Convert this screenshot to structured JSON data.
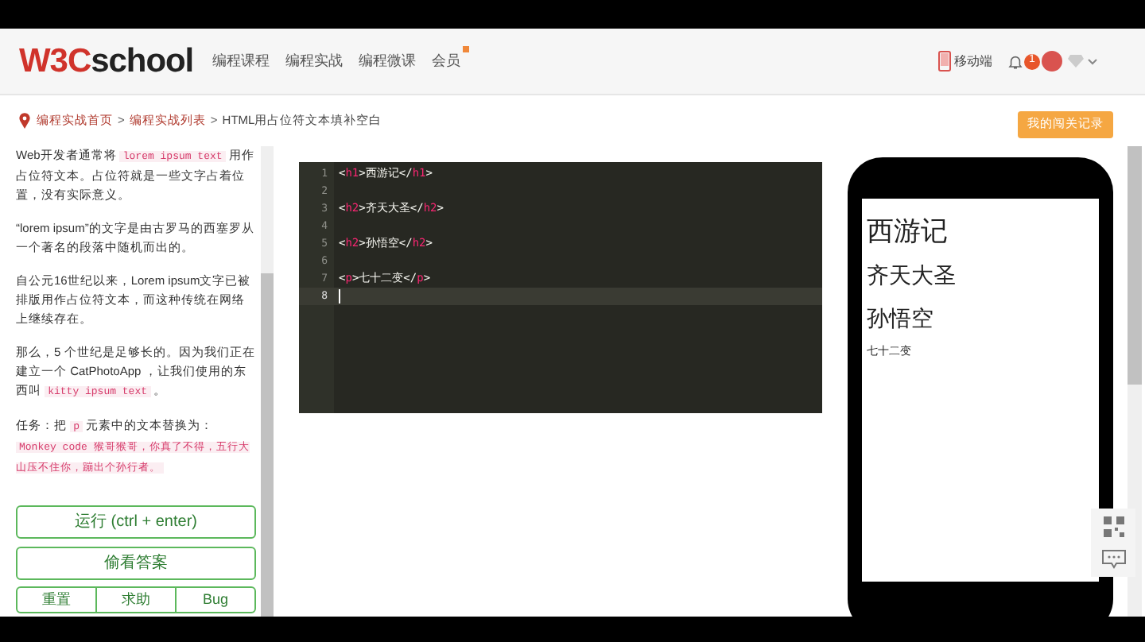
{
  "header": {
    "logo": {
      "accent": "W3C",
      "rest": "school"
    },
    "nav": [
      {
        "label": "编程课程",
        "badge": false
      },
      {
        "label": "编程实战",
        "badge": false
      },
      {
        "label": "编程微课",
        "badge": false
      },
      {
        "label": "会员",
        "badge": true
      }
    ],
    "mobile_link": "移动端",
    "notification_count": "1"
  },
  "breadcrumb": {
    "items": [
      "编程实战首页",
      "编程实战列表",
      "HTML用占位符文本填补空白"
    ],
    "separator": ">"
  },
  "record_button": "我的闯关记录",
  "lesson": [
    [
      {
        "kind": "text",
        "text": "Web开发者通常将 "
      },
      {
        "kind": "code",
        "text": "lorem ipsum text"
      },
      {
        "kind": "text",
        "text": " 用作占位符文本。占位符就是一些文字占着位置，没有实际意义。"
      }
    ],
    [
      {
        "kind": "text",
        "text": "“lorem ipsum”的文字是由古罗马的西塞罗从一个著名的段落中随机而出的。"
      }
    ],
    [
      {
        "kind": "text",
        "text": "自公元16世纪以来，Lorem ipsum文字已被排版用作占位符文本，而这种传统在网络上继续存在。"
      }
    ],
    [
      {
        "kind": "text",
        "text": "那么，5 个世纪是足够长的。因为我们正在建立一个 CatPhotoApp ，让我们使用的东西叫 "
      },
      {
        "kind": "code",
        "text": "kitty ipsum text"
      },
      {
        "kind": "text",
        "text": " 。"
      }
    ],
    [
      {
        "kind": "text",
        "text": "任务：把 "
      },
      {
        "kind": "code",
        "text": "p"
      },
      {
        "kind": "text",
        "text": " 元素中的文本替换为： "
      },
      {
        "kind": "code",
        "text": "Monkey code 猴哥猴哥，你真了不得，五行大山压不住你，蹦出个孙行者。"
      }
    ]
  ],
  "buttons": {
    "run": "运行 (ctrl + enter)",
    "peek": "偷看答案",
    "bottom": [
      "重置",
      "求助",
      "Bug"
    ]
  },
  "editor": {
    "lines": [
      {
        "number": "1",
        "code": "<h1>西游记</h1>",
        "selected": false
      },
      {
        "number": "2",
        "selected": false
      },
      {
        "number": "3",
        "code": "<h2>齐天大圣</h2>",
        "selected": false
      },
      {
        "number": "4",
        "selected": false
      },
      {
        "number": "5",
        "code": "<h2>孙悟空</h2>",
        "selected": false
      },
      {
        "number": "6",
        "selected": false
      },
      {
        "number": "7",
        "code": "<p>七十二变</p>",
        "selected": false
      },
      {
        "number": "8",
        "selected": true
      }
    ]
  },
  "preview": [
    {
      "kind": "h1",
      "text": "西游记"
    },
    {
      "kind": "h2",
      "text": "齐天大圣"
    },
    {
      "kind": "h2",
      "text": "孙悟空"
    },
    {
      "kind": "p",
      "text": "七十二变"
    }
  ]
}
